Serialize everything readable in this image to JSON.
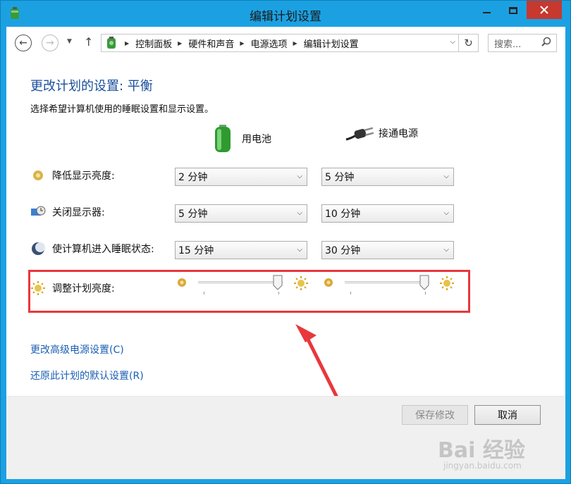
{
  "window": {
    "title": "编辑计划设置",
    "accent": "#1ba1e2",
    "close_color": "#c7382e"
  },
  "nav": {
    "breadcrumbs": [
      "控制面板",
      "硬件和声音",
      "电源选项",
      "编辑计划设置"
    ],
    "search_placeholder": "搜索..."
  },
  "page": {
    "heading": "更改计划的设置: 平衡",
    "subtitle": "选择希望计算机使用的睡眠设置和显示设置。",
    "col_battery": "用电池",
    "col_plugged": "接通电源"
  },
  "settings": [
    {
      "label": "降低显示亮度:",
      "icon": "dim-display-icon",
      "battery": "2 分钟",
      "plugged": "5 分钟"
    },
    {
      "label": "关闭显示器:",
      "icon": "display-off-icon",
      "battery": "5 分钟",
      "plugged": "10 分钟"
    },
    {
      "label": "使计算机进入睡眠状态:",
      "icon": "sleep-moon-icon",
      "battery": "15 分钟",
      "plugged": "30 分钟"
    }
  ],
  "brightness": {
    "label": "调整计划亮度:",
    "battery_level": 1.0,
    "plugged_level": 1.0
  },
  "links": {
    "advanced": "更改高级电源设置(C)",
    "restore": "还原此计划的默认设置(R)"
  },
  "buttons": {
    "save": "保存修改",
    "cancel": "取消"
  },
  "watermark": {
    "text": "Bai 经验",
    "url": "jingyan.baidu.com"
  },
  "colors": {
    "link": "#1a5fb4",
    "heading": "#1a4f9c",
    "highlight": "#e8383d"
  }
}
